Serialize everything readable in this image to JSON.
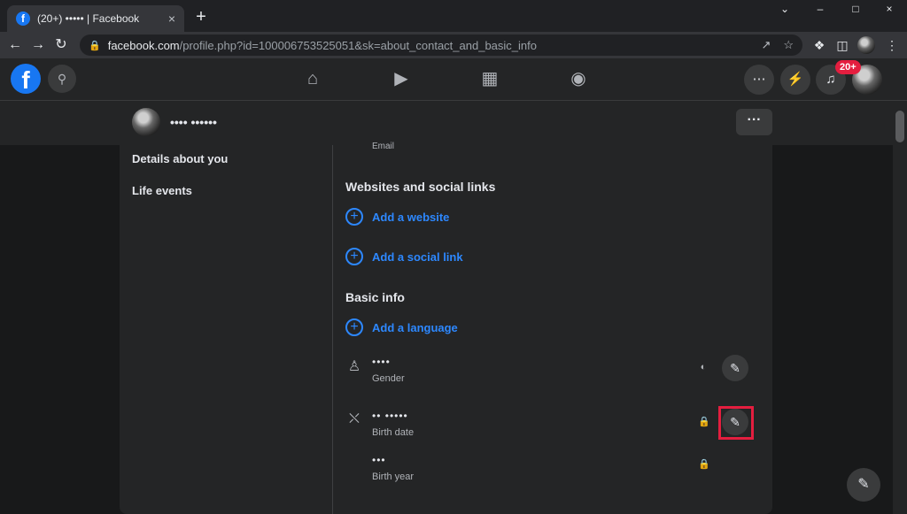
{
  "browser": {
    "tab_title": "(20+) ••••• | Facebook",
    "tab_close": "×",
    "new_tab": "+",
    "url_host": "facebook.com",
    "url_path": "/profile.php?id=100006753525051&sk=about_contact_and_basic_info",
    "win_min": "–",
    "win_max": "□",
    "win_close": "×",
    "win_collapse": "⌄"
  },
  "fb": {
    "logo": "f",
    "notif_badge": "20+",
    "profile_name": "•••• ••••••",
    "more": "···"
  },
  "sidebar": {
    "items": [
      "Details about you",
      "Life events"
    ]
  },
  "main": {
    "email_label_partial": "Email",
    "websites_title": "Websites and social links",
    "add_website": "Add a website",
    "add_social": "Add a social link",
    "basic_info_title": "Basic info",
    "add_language": "Add a language",
    "gender": {
      "value": "••••",
      "label": "Gender"
    },
    "birth_date": {
      "value": "•• •••••",
      "label": "Birth date"
    },
    "birth_year": {
      "value": "•••",
      "label": "Birth year"
    }
  },
  "icons": {
    "back": "arrow-left-icon",
    "forward": "arrow-right-icon",
    "reload": "reload-icon",
    "lock": "lock-icon",
    "share": "share-icon",
    "star": "star-icon",
    "extensions": "puzzle-icon",
    "sidepanel": "sidepanel-icon",
    "home": "home-icon",
    "watch": "video-icon",
    "marketplace": "store-icon",
    "groups": "groups-icon",
    "menu": "grid-icon",
    "messenger": "messenger-icon",
    "notifications": "bell-icon",
    "edit": "pencil-icon",
    "compose": "compose-icon"
  },
  "colors": {
    "accent": "#2d88ff",
    "brand": "#1877f2",
    "badge": "#e41e3f",
    "highlight": "#e41e3f"
  }
}
